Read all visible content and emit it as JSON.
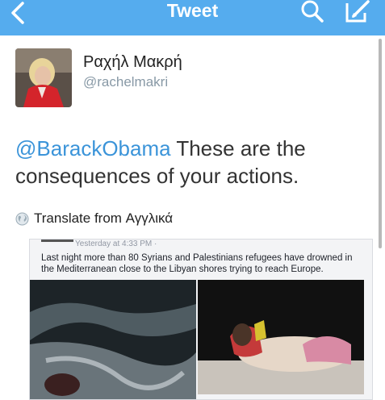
{
  "nav": {
    "title": "Tweet",
    "back_icon": "chevron-left-icon",
    "search_icon": "search-icon",
    "compose_icon": "compose-icon",
    "bar_color": "#55acee"
  },
  "user": {
    "display_name": "Ραχήλ Μακρή",
    "handle": "@rachelmakri"
  },
  "tweet": {
    "mention": "@BarackObama",
    "text": " These are the consequences of your actions.",
    "mention_color": "#3b94d9"
  },
  "translate": {
    "label": "Translate from Αγγλικά",
    "icon": "globe-icon"
  },
  "media": {
    "post_time": "Yesterday at 4:33 PM · ",
    "post_text": "Last night more than 80 Syrians and Palestinians refugees have drowned in the Mediterranean close to the Libyan shores trying to reach Europe."
  }
}
